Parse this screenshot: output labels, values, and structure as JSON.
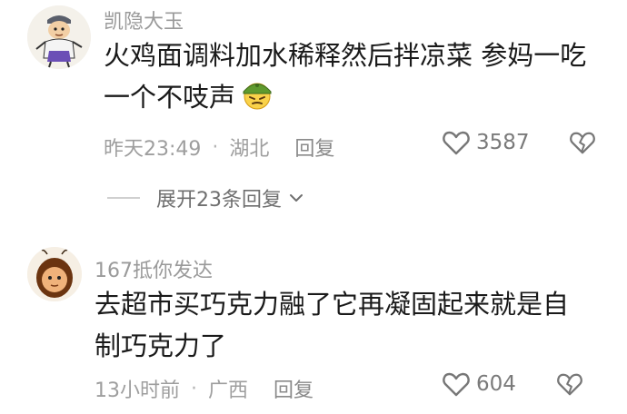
{
  "comments": [
    {
      "username": "凯隐大玉",
      "lines": [
        "火鸡面调料加水稀释然后拌凉菜 参妈一吃",
        "一个不吱声"
      ],
      "emoji": "army-helmet-emoji",
      "time": "昨天23:49",
      "location": "湖北",
      "reply_label": "回复",
      "likes": "3587",
      "replies_expand": "展开23条回复"
    },
    {
      "username": "167抵你发达",
      "lines": [
        "去超市买巧克力融了它再凝固起来就是自",
        "制巧克力了"
      ],
      "time": "13小时前",
      "location": "广西",
      "reply_label": "回复",
      "likes": "604"
    }
  ],
  "separator": "·",
  "icons": {
    "like": "heart-outline-icon",
    "dislike": "broken-heart-icon",
    "expand": "chevron-down-icon"
  }
}
